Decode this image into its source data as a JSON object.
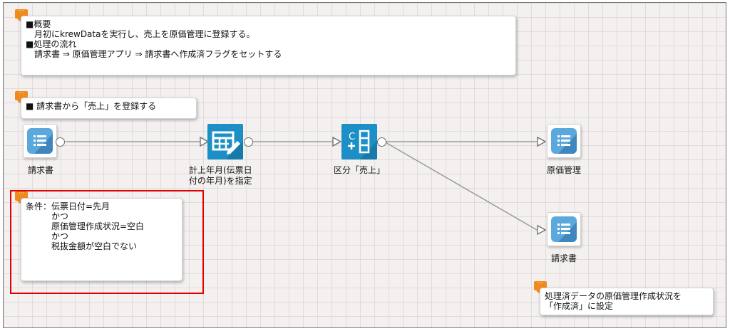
{
  "notes": {
    "overview": "■概要\n　月初にkrewDataを実行し、売上を原価管理に登録する。\n■処理の流れ\n　請求書 ⇒ 原価管理アプリ ⇒ 請求書へ作成済フラグをセットする",
    "section": "■ 請求書から「売上」を登録する",
    "condition": "条件：伝票日付=先月\n　　　かつ\n　　　原価管理作成状況=空白\n　　　かつ\n　　　税抜金額が空白でない",
    "set_flag": "処理済データの原価管理作成状況を\n「作成済」に設定",
    "tag_glyph": "···"
  },
  "nodes": {
    "invoice_source": "請求書",
    "month_set": "計上年月(伝票日\n付の年月)を指定",
    "category_sales": "区分「売上」",
    "cost_mgmt": "原価管理",
    "invoice_out": "請求書"
  },
  "colors": {
    "accent": "#f08a1c",
    "highlight": "#e00000",
    "app_icon": "#5aa8dc",
    "cmd_icon": "#1c8fc7"
  },
  "icons": {
    "invoice_source": "app-table-icon",
    "month_set": "edit-table-icon",
    "category_sales": "formula-column-icon",
    "cost_mgmt": "app-table-icon",
    "invoice_out": "app-table-icon"
  }
}
